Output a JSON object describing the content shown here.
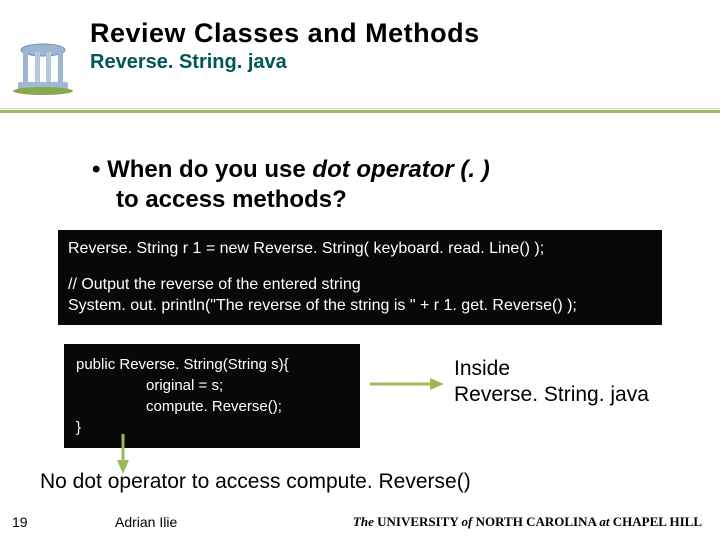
{
  "header": {
    "title": "Review Classes and Methods",
    "subtitle": "Reverse. String. java"
  },
  "bullet": {
    "prefix": "• When do you use ",
    "italic": "dot operator (. )",
    "suffix": "to access methods?"
  },
  "code1": {
    "line1": "Reverse. String r 1 = new Reverse. String( keyboard. read. Line() );",
    "line2": "// Output the reverse of the entered string",
    "line3": "System. out. println(\"The reverse of the string is \" + r 1. get. Reverse() );"
  },
  "code2": {
    "line1": "public Reverse. String(String s){",
    "line2": "original = s;",
    "line3": "compute. Reverse();",
    "line4": "}"
  },
  "inside": {
    "line1": "Inside",
    "line2": "Reverse. String. java"
  },
  "bottom": "No dot operator to access compute. Reverse()",
  "footer": {
    "page": "19",
    "author": "Adrian Ilie",
    "univ_the": "The",
    "univ_uni": " UNIVERSITY ",
    "univ_of": "of",
    "univ_nc": " NORTH CAROLINA ",
    "univ_at": "at",
    "univ_ch": " CHAPEL HILL"
  }
}
